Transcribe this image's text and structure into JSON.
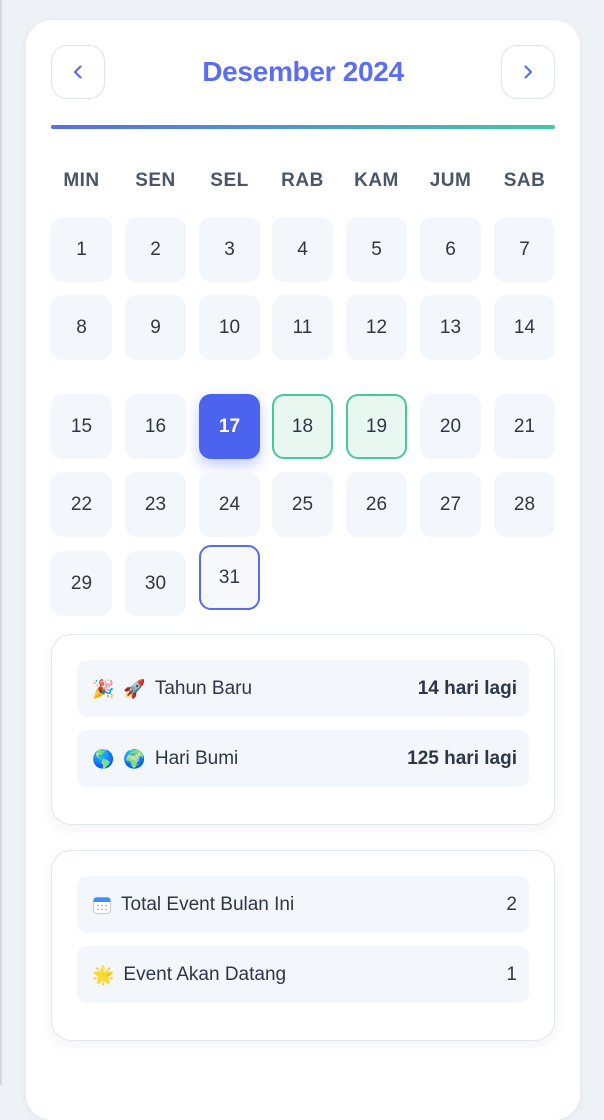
{
  "calendar": {
    "month_title": "Desember 2024",
    "weekdays": [
      "MIN",
      "SEN",
      "SEL",
      "RAB",
      "KAM",
      "JUM",
      "SAB"
    ],
    "days": [
      "1",
      "2",
      "3",
      "4",
      "5",
      "6",
      "7",
      "8",
      "9",
      "10",
      "11",
      "12",
      "13",
      "14",
      "15",
      "16",
      "17",
      "18",
      "19",
      "20",
      "21",
      "22",
      "23",
      "24",
      "25",
      "26",
      "27",
      "28",
      "29",
      "30",
      "31"
    ],
    "today": "17",
    "event_days": [
      "18",
      "19"
    ],
    "outlined_day": "31",
    "prev_icon": "chevron-left-icon",
    "next_icon": "chevron-right-icon",
    "colors": {
      "accent": "#5b6ef0",
      "today_bg": "#4c63f0",
      "event_border": "#45c99a",
      "gradient_start": "#5a6ce8",
      "gradient_end": "#45c7a5"
    }
  },
  "upcoming": [
    {
      "icon1": "🎉",
      "icon2": "🚀",
      "name": "Tahun Baru",
      "countdown": "14 hari lagi"
    },
    {
      "icon1": "🌎",
      "icon2": "🌍",
      "name": "Hari Bumi",
      "countdown": "125 hari lagi"
    }
  ],
  "stats": [
    {
      "icon": "calendar-icon",
      "label": "Total Event Bulan Ini",
      "value": "2"
    },
    {
      "icon": "sun-icon",
      "icon_glyph": "🌟",
      "label": "Event Akan Datang",
      "value": "1"
    }
  ]
}
